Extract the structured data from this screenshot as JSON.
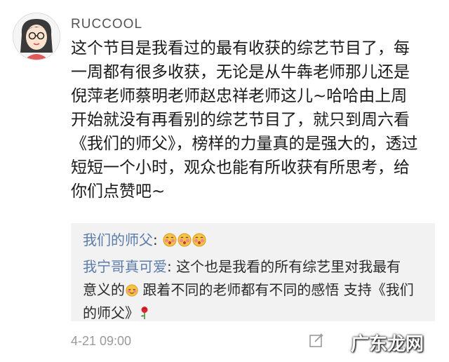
{
  "post": {
    "username": "RUCCOOL",
    "content_lines": [
      "这个节目是我看过的最有收获的综艺节目了，每",
      "一周都有很多收获，无论是从牛犇老师那儿还是",
      "倪萍老师蔡明老师赵忠祥老师这儿~哈哈由上周",
      "开始就没有再看别的综艺节目了，就只到周六看",
      "《我们的师父》，榜样的力量真的是强大的，透过",
      "短短一个小时，观众也能有所收获有所思考，给",
      "你们点赞吧~"
    ],
    "time": "4-21 09:00"
  },
  "replies": [
    {
      "user": "我们的师父",
      "sep": ": ",
      "lines": [],
      "emojis": [
        "blush-emoji",
        "blush-emoji",
        "blush-emoji"
      ]
    },
    {
      "user": "我宁哥真可爱",
      "sep": ": ",
      "line1": "这个也是我看的所有综艺里对我最有",
      "line2a": "意义的",
      "line2b": " 跟着不同的老师都有不同的感悟 支持《我们",
      "line3": "的师父》"
    }
  ],
  "watermark": "广东龙网",
  "icons": {
    "avatar": "cartoon-avatar-icon",
    "edit": "edit-icon",
    "emoji": "blush-emoji",
    "rose": "rose-icon"
  },
  "colors": {
    "username": "#555555",
    "reply_user": "#5b7bab",
    "reply_bg": "#f2f2f2",
    "time": "#9a9a9a"
  }
}
